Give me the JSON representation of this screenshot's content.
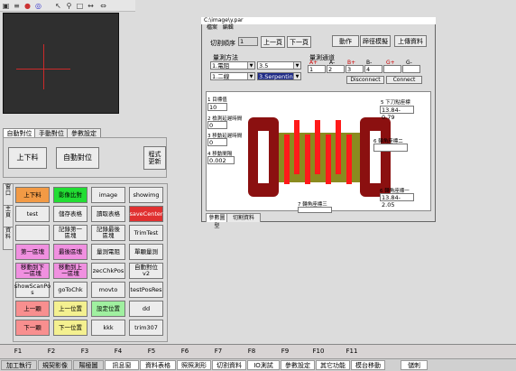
{
  "toolbar": {
    "icons": [
      "image-icon",
      "text-icon",
      "record-icon",
      "target-icon",
      "pointer-icon",
      "rect-icon",
      "zoom-icon",
      "arrows-h-icon",
      "arrows-icon"
    ]
  },
  "tabs_top": [
    "自動對位",
    "手動對位",
    "參數設定"
  ],
  "panel_top": {
    "btn1": "上下料",
    "btn2": "自動對位",
    "btn3": "程式\n更新"
  },
  "side_tabs": [
    "窗口",
    "主頁",
    "資料"
  ],
  "grid": [
    {
      "label": "上下料",
      "color": "orange"
    },
    {
      "label": "影像比對",
      "color": "green"
    },
    {
      "label": "image",
      "color": ""
    },
    {
      "label": "showimg",
      "color": ""
    },
    {
      "label": "test",
      "color": ""
    },
    {
      "label": "儲存表格",
      "color": ""
    },
    {
      "label": "讀取表格",
      "color": ""
    },
    {
      "label": "saveCenter",
      "color": "red"
    },
    {
      "label": "",
      "color": ""
    },
    {
      "label": "記錄第一\n區塊",
      "color": ""
    },
    {
      "label": "記錄最後\n區塊",
      "color": ""
    },
    {
      "label": "TrimTest",
      "color": ""
    },
    {
      "label": "第一區塊",
      "color": "pink"
    },
    {
      "label": "最後區塊",
      "color": "pink"
    },
    {
      "label": "量測電阻",
      "color": ""
    },
    {
      "label": "單顆量測",
      "color": ""
    },
    {
      "label": "移動到下\n一區塊",
      "color": "pink"
    },
    {
      "label": "移動到上\n一區塊",
      "color": "pink"
    },
    {
      "label": "zecChkPos",
      "color": ""
    },
    {
      "label": "自動對位\nv2",
      "color": ""
    },
    {
      "label": "showScanPo\ns",
      "color": ""
    },
    {
      "label": "goToChk",
      "color": ""
    },
    {
      "label": "movto",
      "color": ""
    },
    {
      "label": "testPosRes",
      "color": ""
    },
    {
      "label": "上一顆",
      "color": "salmon"
    },
    {
      "label": "上一位置",
      "color": "yellow"
    },
    {
      "label": "設定位置",
      "color": "lgreen"
    },
    {
      "label": "dd",
      "color": ""
    },
    {
      "label": "下一顆",
      "color": "salmon"
    },
    {
      "label": "下一位置",
      "color": "yellow"
    },
    {
      "label": "kkk",
      "color": ""
    },
    {
      "label": "trim307",
      "color": ""
    }
  ],
  "dialog": {
    "title": "C:\\image\\y.par",
    "menu": [
      "檔案",
      "編輯"
    ],
    "cut_order_label": "切割順序",
    "cut_order_value": "1",
    "prev_label": "上一頁",
    "next_label": "下一頁",
    "action_label": "動作",
    "avoid_label": "蹄徑模擬",
    "upload_label": "上傳資料",
    "method_group": "量測方法",
    "method1": "1.電阻",
    "method1b": "3.5",
    "method2": "1.二線",
    "method2b": "3.Serpentine",
    "channel_group": "量測通道",
    "channel_headers": [
      "A+",
      "A-",
      "B+",
      "B-",
      "G+",
      "G-"
    ],
    "channel_values": [
      "1",
      "2",
      "3",
      "4",
      "",
      ""
    ],
    "disconnect_label": "Disconnect",
    "connect_label": "Connect",
    "params": [
      {
        "label": "1 目標值",
        "value": "10"
      },
      {
        "label": "2 檢測延遲時間",
        "value": "0"
      },
      {
        "label": "3 移動延遲時間",
        "value": "0"
      },
      {
        "label": "4 移動間隔",
        "value": "0.002"
      }
    ],
    "coord_top_label": "5 下刀點座標",
    "coord_top_value": "13.84-0.79",
    "coord_mid_label": "6 轉角座標二",
    "coord_mid_value": "",
    "coord_br_label": "6 轉角座標一",
    "coord_br_value": "13.84-2.05",
    "coord_bottom_label": "7 轉角座標三",
    "coord_bottom_value": "",
    "tabs": [
      "參數圖型",
      "切割資料"
    ]
  },
  "fkeys": [
    "F1",
    "F2",
    "F3",
    "F4",
    "F5",
    "F6",
    "F7",
    "F8",
    "F9",
    "F10",
    "F11"
  ],
  "status": [
    "加工執行",
    "規契影像",
    "陽極圖",
    "訊息窗",
    "資料表格",
    "照照測形",
    "切割資料",
    "IO測試",
    "參數設定",
    "其它功能",
    "模台移動",
    "儲刺"
  ]
}
